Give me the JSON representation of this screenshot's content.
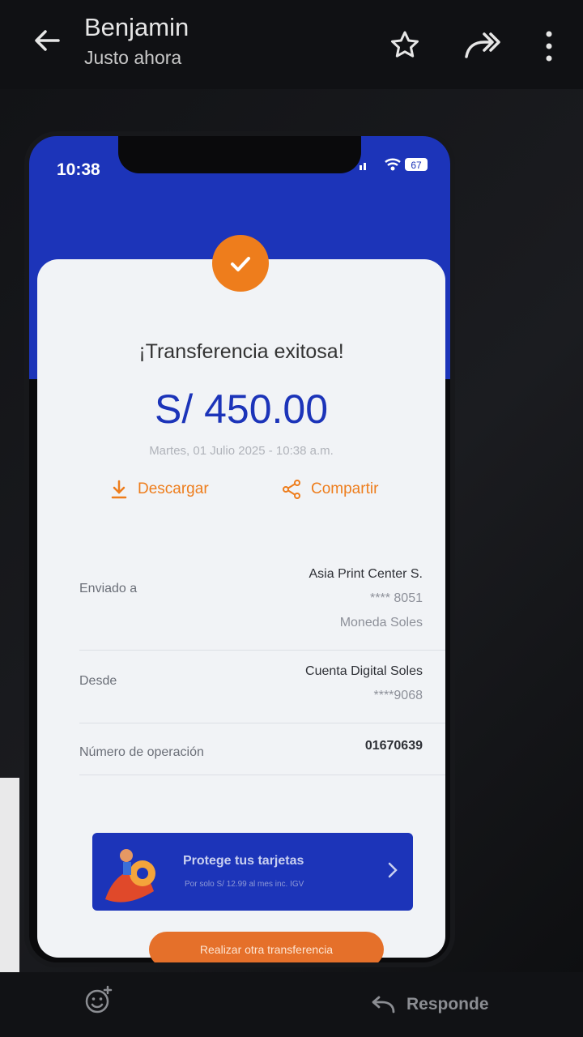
{
  "header": {
    "sender": "Benjamin",
    "time_ago": "Justo ahora"
  },
  "phone": {
    "clock": "10:38",
    "battery": "67",
    "receipt": {
      "title": "¡Transferencia exitosa!",
      "amount": "S/ 450.00",
      "date": "Martes, 01 Julio 2025 - 10:38 a.m.",
      "download_label": "Descargar",
      "share_label": "Compartir",
      "sent_to_label": "Enviado a",
      "recipient_name": "Asia Print Center S.",
      "recipient_account": "**** 8051",
      "recipient_currency": "Moneda Soles",
      "from_label": "Desde",
      "from_account_name": "Cuenta Digital Soles",
      "from_account_number": "****9068",
      "operation_label": "Número de operación",
      "operation_number": "01670639"
    },
    "banner": {
      "title": "Protege tus tarjetas",
      "subtitle": "Por solo S/ 12.99 al mes inc. IGV"
    },
    "cta_label": "Realizar otra transferencia"
  },
  "footer": {
    "reply_label": "Responde"
  },
  "colors": {
    "bank_blue": "#1c34b9",
    "accent_orange": "#ee7d1c"
  }
}
